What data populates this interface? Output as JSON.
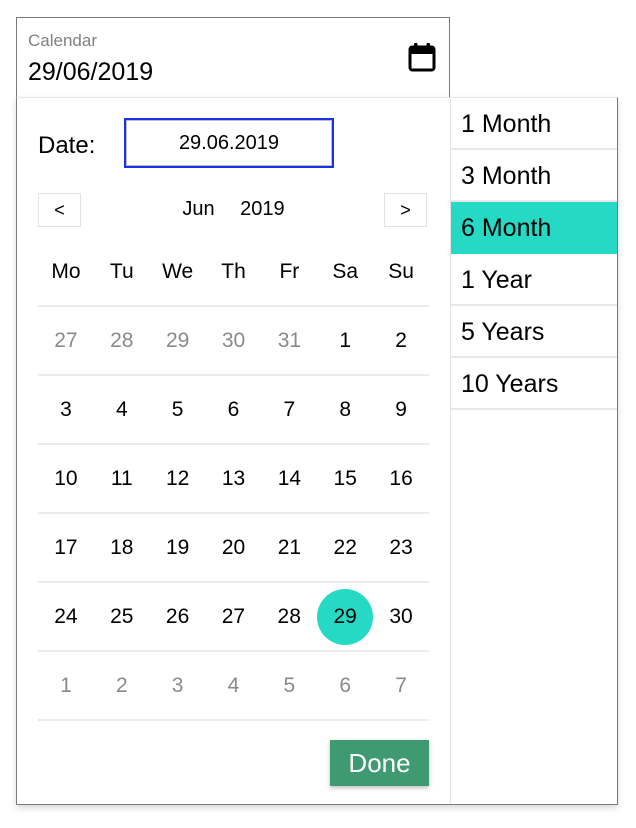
{
  "field": {
    "label": "Calendar",
    "value": "29/06/2019",
    "icon": "calendar-icon"
  },
  "picker": {
    "date_label": "Date:",
    "date_input_value": "29.06.2019",
    "prev_label": "<",
    "next_label": ">",
    "month": "Jun",
    "year": "2019",
    "weekdays": [
      "Mo",
      "Tu",
      "We",
      "Th",
      "Fr",
      "Sa",
      "Su"
    ],
    "weeks": [
      [
        {
          "d": "27",
          "other": true
        },
        {
          "d": "28",
          "other": true
        },
        {
          "d": "29",
          "other": true
        },
        {
          "d": "30",
          "other": true
        },
        {
          "d": "31",
          "other": true
        },
        {
          "d": "1"
        },
        {
          "d": "2"
        }
      ],
      [
        {
          "d": "3"
        },
        {
          "d": "4"
        },
        {
          "d": "5"
        },
        {
          "d": "6"
        },
        {
          "d": "7"
        },
        {
          "d": "8"
        },
        {
          "d": "9"
        }
      ],
      [
        {
          "d": "10"
        },
        {
          "d": "11"
        },
        {
          "d": "12"
        },
        {
          "d": "13"
        },
        {
          "d": "14"
        },
        {
          "d": "15"
        },
        {
          "d": "16"
        }
      ],
      [
        {
          "d": "17"
        },
        {
          "d": "18"
        },
        {
          "d": "19"
        },
        {
          "d": "20"
        },
        {
          "d": "21"
        },
        {
          "d": "22"
        },
        {
          "d": "23"
        }
      ],
      [
        {
          "d": "24"
        },
        {
          "d": "25"
        },
        {
          "d": "26"
        },
        {
          "d": "27"
        },
        {
          "d": "28"
        },
        {
          "d": "29",
          "selected": true
        },
        {
          "d": "30"
        }
      ],
      [
        {
          "d": "1",
          "other": true
        },
        {
          "d": "2",
          "other": true
        },
        {
          "d": "3",
          "other": true
        },
        {
          "d": "4",
          "other": true
        },
        {
          "d": "5",
          "other": true
        },
        {
          "d": "6",
          "other": true
        },
        {
          "d": "7",
          "other": true
        }
      ]
    ],
    "done_label": "Done"
  },
  "ranges": {
    "options": [
      "1 Month",
      "3 Month",
      "6 Month",
      "1 Year",
      "5 Years",
      "10 Years"
    ],
    "selected_index": 2
  },
  "colors": {
    "accent": "#25d9c5",
    "done_button": "#3f9a72",
    "focus_border": "#1a32e6"
  }
}
